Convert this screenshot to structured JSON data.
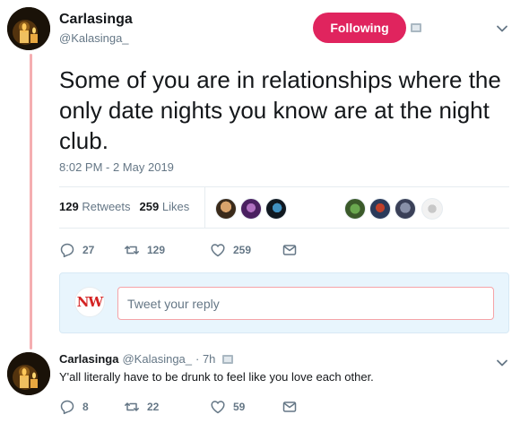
{
  "tweet": {
    "author_name": "Carlasinga",
    "author_handle": "@Kalasinga_",
    "follow_label": "Following",
    "text": "Some of you are in relationships where the only date nights you know are at the night club.",
    "timestamp": "8:02 PM - 2 May 2019",
    "retweets_count": "129",
    "retweets_label": "Retweets",
    "likes_count": "259",
    "likes_label": "Likes",
    "actions": {
      "replies": "27",
      "retweets": "129",
      "likes": "259"
    }
  },
  "reply_composer": {
    "avatar_text": "NW",
    "placeholder": "Tweet your reply"
  },
  "reply": {
    "author_name": "Carlasinga",
    "author_handle": "@Kalasinga_",
    "time": "· 7h",
    "text": "Y'all literally have to be drunk to feel like you love each other.",
    "actions": {
      "replies": "8",
      "retweets": "22",
      "likes": "59"
    }
  },
  "colors": {
    "accent_follow": "#e0245e",
    "thread_line": "#f5aeb1",
    "muted_text": "#657786",
    "composer_bg": "#e8f5fd"
  },
  "icons": [
    "reply-icon",
    "retweet-icon",
    "heart-icon",
    "message-icon",
    "chevron-down-icon",
    "image-icon"
  ]
}
